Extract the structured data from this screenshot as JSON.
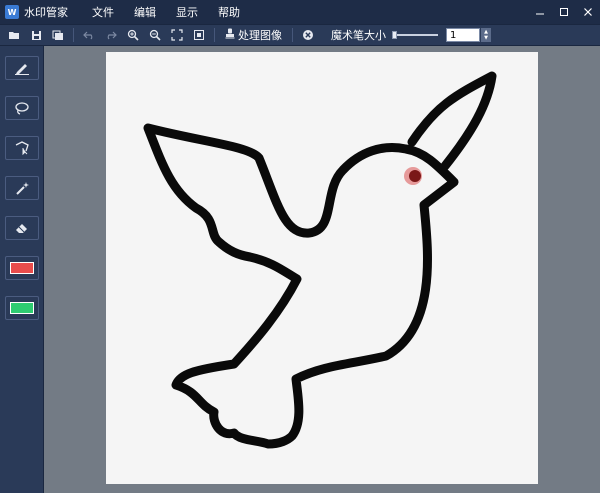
{
  "app": {
    "title": "水印管家",
    "icon_letters": "W"
  },
  "menu": [
    "文件",
    "编辑",
    "显示",
    "帮助"
  ],
  "window_controls": [
    "minimize-icon",
    "maximize-icon",
    "close-icon"
  ],
  "toolbar": {
    "icons": [
      "open-icon",
      "save-icon",
      "save-as-icon",
      "undo-icon",
      "redo-icon",
      "zoom-in-icon",
      "zoom-out-icon",
      "fit-icon",
      "actual-size-icon"
    ],
    "process_label": "处理图像",
    "clear_icon": "clear-icon",
    "brush_size_label": "魔术笔大小",
    "brush_size_value": "1",
    "brush_size_slider_fraction": 0.0
  },
  "tools": [
    "pen-tool-icon",
    "lasso-tool-icon",
    "poly-lasso-tool-icon",
    "magic-wand-icon",
    "eraser-icon"
  ],
  "swatches": {
    "primary": "#e84c4c",
    "secondary": "#2ecc71"
  },
  "colors": {
    "accent": "#2a3a58",
    "titlebar": "#1e2c47",
    "workspace": "#737b85",
    "canvas": "#f5f5f5"
  }
}
